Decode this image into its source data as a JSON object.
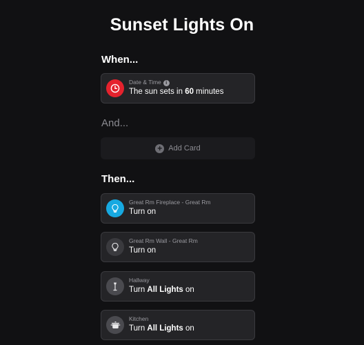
{
  "title": "Sunset Lights On",
  "when_label": "When...",
  "and_label": "And...",
  "then_label": "Then...",
  "trigger": {
    "sub": "Date & Time",
    "info_icon_text": "i",
    "text_prefix": "The sun sets in ",
    "text_bold": "60",
    "text_suffix": " minutes",
    "icon": "clock-icon",
    "icon_bg": "#e5222d"
  },
  "add_card": {
    "label": "Add Card",
    "icon_text": "+"
  },
  "actions": [
    {
      "sub": "Great Rm Fireplace - Great Rm",
      "text_prefix": "Turn on",
      "text_bold": "",
      "text_suffix": "",
      "icon": "lightbulb-icon",
      "icon_bg": "#17a9e1"
    },
    {
      "sub": "Great Rm Wall - Great Rm",
      "text_prefix": "Turn on",
      "text_bold": "",
      "text_suffix": "",
      "icon": "lightbulb-off-icon",
      "icon_bg": "#3a3a3e"
    },
    {
      "sub": "Hallway",
      "text_prefix": "Turn ",
      "text_bold": "All Lights",
      "text_suffix": " on",
      "icon": "floor-lamp-icon",
      "icon_bg": "#4a4a4f"
    },
    {
      "sub": "Kitchen",
      "text_prefix": "Turn ",
      "text_bold": "All Lights",
      "text_suffix": " on",
      "icon": "cooking-pot-icon",
      "icon_bg": "#4a4a4f"
    }
  ]
}
